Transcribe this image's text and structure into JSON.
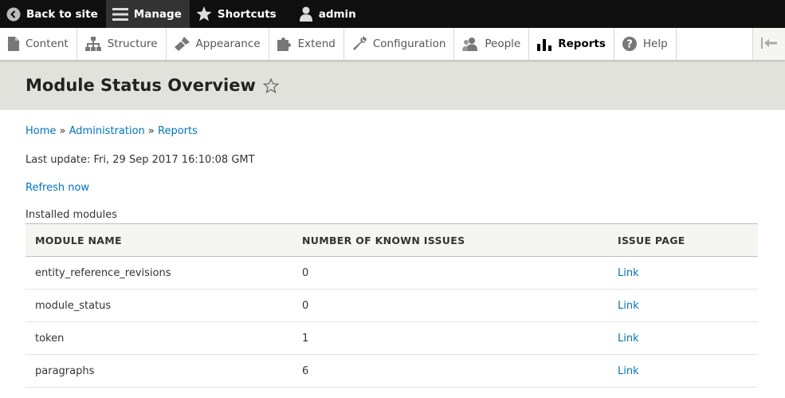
{
  "toolbar": {
    "back": "Back to site",
    "manage": "Manage",
    "shortcuts": "Shortcuts",
    "user": "admin"
  },
  "tray": {
    "items": [
      {
        "label": "Content",
        "icon": "file-icon"
      },
      {
        "label": "Structure",
        "icon": "sitemap-icon"
      },
      {
        "label": "Appearance",
        "icon": "brush-icon"
      },
      {
        "label": "Extend",
        "icon": "puzzle-icon"
      },
      {
        "label": "Configuration",
        "icon": "wrench-icon"
      },
      {
        "label": "People",
        "icon": "people-icon"
      },
      {
        "label": "Reports",
        "icon": "bar-chart-icon",
        "active": true
      },
      {
        "label": "Help",
        "icon": "help-icon"
      }
    ]
  },
  "page": {
    "title": "Module Status Overview",
    "breadcrumb": [
      "Home",
      "Administration",
      "Reports"
    ],
    "breadcrumb_sep": "»",
    "last_update": "Last update: Fri, 29 Sep 2017 16:10:08 GMT",
    "refresh": "Refresh now",
    "caption": "Installed modules"
  },
  "table": {
    "headers": [
      "MODULE NAME",
      "NUMBER OF KNOWN ISSUES",
      "ISSUE PAGE"
    ],
    "rows": [
      {
        "name": "entity_reference_revisions",
        "issues": "0",
        "link": "Link"
      },
      {
        "name": "module_status",
        "issues": "0",
        "link": "Link"
      },
      {
        "name": "token",
        "issues": "1",
        "link": "Link"
      },
      {
        "name": "paragraphs",
        "issues": "6",
        "link": "Link"
      }
    ]
  },
  "colors": {
    "toolbar_bg": "#0f0f0f",
    "header_bg": "#e0e2db",
    "link": "#0074bd"
  }
}
